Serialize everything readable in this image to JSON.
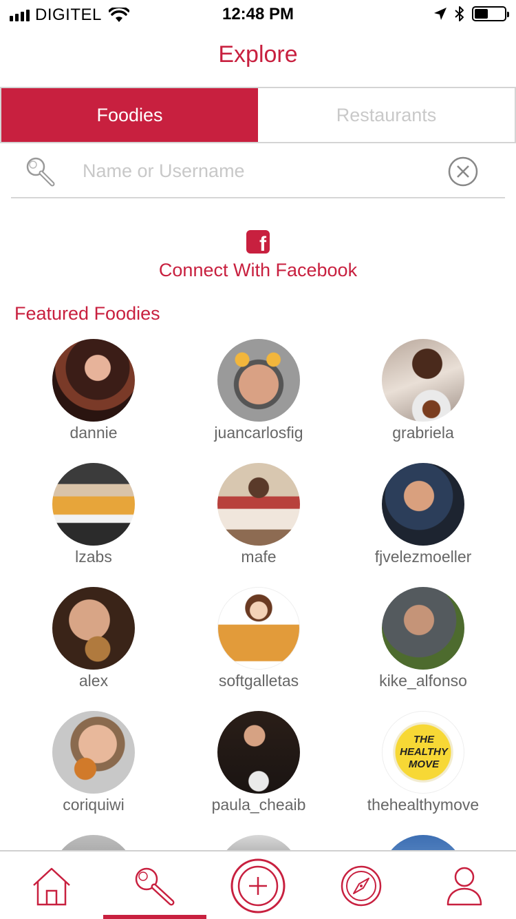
{
  "status_bar": {
    "carrier": "DIGITEL",
    "time": "12:48 PM",
    "battery_level": 0.45
  },
  "nav": {
    "title": "Explore"
  },
  "segments": {
    "foodies": "Foodies",
    "restaurants": "Restaurants",
    "active": "foodies"
  },
  "search": {
    "placeholder": "Name or Username",
    "value": ""
  },
  "facebook": {
    "label": "Connect With Facebook"
  },
  "featured": {
    "title": "Featured Foodies",
    "items": [
      {
        "username": "dannie"
      },
      {
        "username": "juancarlosfig"
      },
      {
        "username": "grabriela"
      },
      {
        "username": "lzabs"
      },
      {
        "username": "mafe"
      },
      {
        "username": "fjvelezmoeller"
      },
      {
        "username": "alex"
      },
      {
        "username": "softgalletas"
      },
      {
        "username": "kike_alfonso"
      },
      {
        "username": "coriquiwi"
      },
      {
        "username": "paula_cheaib"
      },
      {
        "username": "thehealthymove",
        "avatar_text": "THE HEALTHY MOVE"
      }
    ]
  },
  "tab_bar": {
    "items": [
      {
        "icon": "home-icon"
      },
      {
        "icon": "search-icon"
      },
      {
        "icon": "add-icon"
      },
      {
        "icon": "compass-icon"
      },
      {
        "icon": "profile-icon"
      }
    ],
    "active_index": 1
  },
  "colors": {
    "accent": "#c8203f",
    "inactive_text": "#c9c9c9",
    "username": "#666666"
  }
}
